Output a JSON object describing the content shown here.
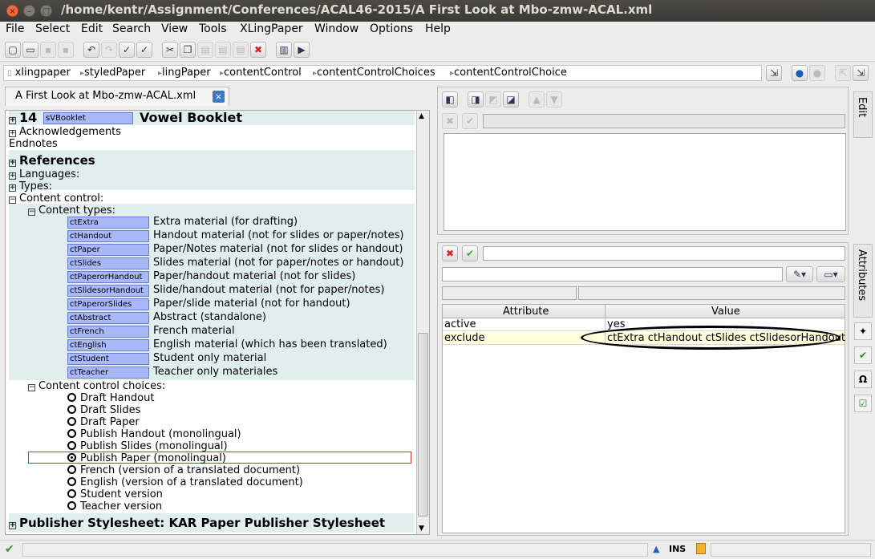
{
  "window": {
    "title": "/home/kentr/Assignment/Conferences/ACAL46-2015/A First Look at Mbo-zmw-ACAL.xml"
  },
  "menu": [
    "File",
    "Select",
    "Edit",
    "Search",
    "View",
    "Tools",
    "XLingPaper",
    "Window",
    "Options",
    "Help"
  ],
  "breadcrumb": [
    "xlingpaper",
    "styledPaper",
    "lingPaper",
    "contentControl",
    "contentControlChoices",
    "contentControlChoice"
  ],
  "editor_tab": {
    "title": "A First Look at Mbo-zmw-ACAL.xml"
  },
  "tree": {
    "booklet_num": "14",
    "booklet_tag": "sVBooklet",
    "booklet_title": "Vowel Booklet",
    "acknowledgements": "Acknowledgements",
    "endnotes": "Endnotes",
    "references": "References",
    "languages": "Languages:",
    "types": "Types:",
    "content_control": "Content control:",
    "content_types_label": "Content types:",
    "content_types": [
      {
        "tag": "ctExtra",
        "desc": "Extra material (for drafting)"
      },
      {
        "tag": "ctHandout",
        "desc": "Handout material (not for slides or paper/notes)"
      },
      {
        "tag": "ctPaper",
        "desc": "Paper/Notes material (not for slides or handout)"
      },
      {
        "tag": "ctSlides",
        "desc": "Slides material (not for paper/notes or handout)"
      },
      {
        "tag": "ctPaperorHandout",
        "desc": "Paper/handout material (not for slides)"
      },
      {
        "tag": "ctSlidesorHandout",
        "desc": "Slide/handout material (not for paper/notes)"
      },
      {
        "tag": "ctPaperorSlides",
        "desc": "Paper/slide material (not for handout)"
      },
      {
        "tag": "ctAbstract",
        "desc": "Abstract (standalone)"
      },
      {
        "tag": "ctFrench",
        "desc": "French material"
      },
      {
        "tag": "ctEnglish",
        "desc": "English material (which has been translated)"
      },
      {
        "tag": "ctStudent",
        "desc": "Student only material"
      },
      {
        "tag": "ctTeacher",
        "desc": "Teacher only materiales"
      }
    ],
    "choices_label": "Content control choices:",
    "choices": [
      "Draft Handout",
      "Draft Slides",
      "Draft Paper",
      "Publish Handout (monolingual)",
      "Publish Slides (monolingual)",
      "Publish Paper (monolingual)",
      "French (version of a translated document)",
      "English (version of a translated document)",
      "Student version",
      "Teacher version"
    ],
    "selected_choice": 5,
    "publisher": "Publisher Stylesheet: KAR Paper Publisher Stylesheet"
  },
  "attributes": {
    "headers": {
      "attribute": "Attribute",
      "value": "Value"
    },
    "rows": [
      {
        "name": "active",
        "value": "yes"
      },
      {
        "name": "exclude",
        "value": "ctExtra ctHandout ctSlides ctSlidesorHandout"
      }
    ]
  },
  "side_tabs": {
    "edit": "Edit",
    "attributes": "Attributes"
  },
  "status": {
    "ins": "INS"
  },
  "colors": {
    "selection_outline": "#c83232",
    "chip": "#a8b8f8",
    "band": "#e0eeee",
    "highlight_row": "#ffffdc"
  }
}
